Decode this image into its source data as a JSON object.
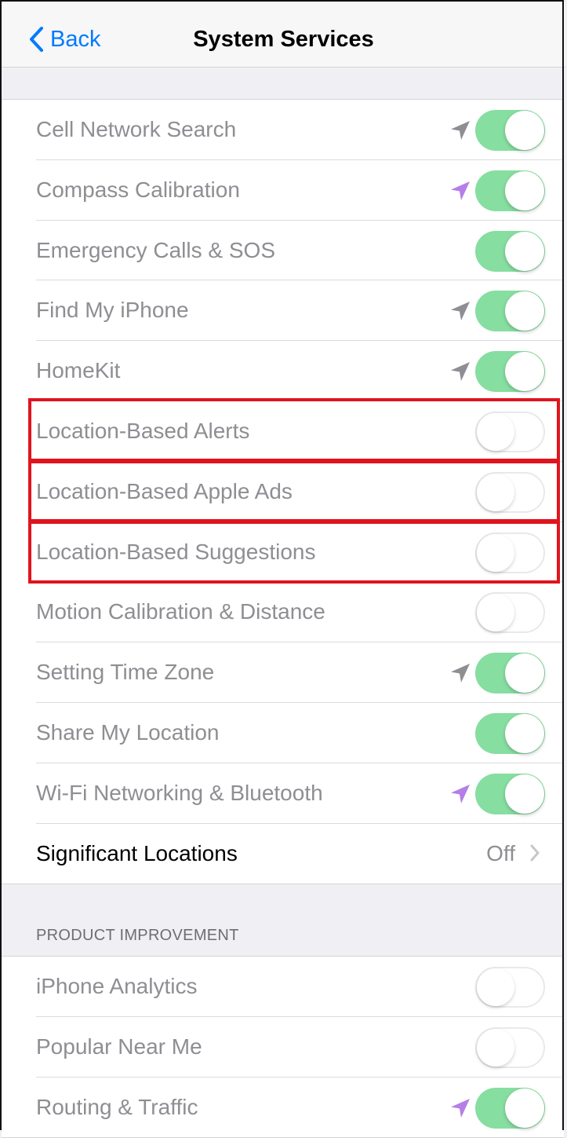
{
  "navbar": {
    "back_label": "Back",
    "title": "System Services"
  },
  "colors": {
    "accent": "#007aff",
    "toggle_on": "#86dea0",
    "location_gray": "#8e8e93",
    "location_purple": "#b57ee8",
    "highlight": "#e0141e"
  },
  "services": [
    {
      "label": "Cell Network Search",
      "enabled": true,
      "location_icon": "gray"
    },
    {
      "label": "Compass Calibration",
      "enabled": true,
      "location_icon": "purple"
    },
    {
      "label": "Emergency Calls & SOS",
      "enabled": true,
      "location_icon": "none"
    },
    {
      "label": "Find My iPhone",
      "enabled": true,
      "location_icon": "gray"
    },
    {
      "label": "HomeKit",
      "enabled": true,
      "location_icon": "gray"
    },
    {
      "label": "Location-Based Alerts",
      "enabled": false,
      "location_icon": "none",
      "highlighted": true
    },
    {
      "label": "Location-Based Apple Ads",
      "enabled": false,
      "location_icon": "none",
      "highlighted": true
    },
    {
      "label": "Location-Based Suggestions",
      "enabled": false,
      "location_icon": "none",
      "highlighted": true
    },
    {
      "label": "Motion Calibration & Distance",
      "enabled": false,
      "location_icon": "none"
    },
    {
      "label": "Setting Time Zone",
      "enabled": true,
      "location_icon": "gray"
    },
    {
      "label": "Share My Location",
      "enabled": true,
      "location_icon": "none"
    },
    {
      "label": "Wi-Fi Networking & Bluetooth",
      "enabled": true,
      "location_icon": "purple"
    }
  ],
  "significant_locations": {
    "label": "Significant Locations",
    "value": "Off"
  },
  "product_improvement": {
    "header": "PRODUCT IMPROVEMENT",
    "items": [
      {
        "label": "iPhone Analytics",
        "enabled": false,
        "location_icon": "none"
      },
      {
        "label": "Popular Near Me",
        "enabled": false,
        "location_icon": "none"
      },
      {
        "label": "Routing & Traffic",
        "enabled": true,
        "location_icon": "purple"
      }
    ]
  }
}
